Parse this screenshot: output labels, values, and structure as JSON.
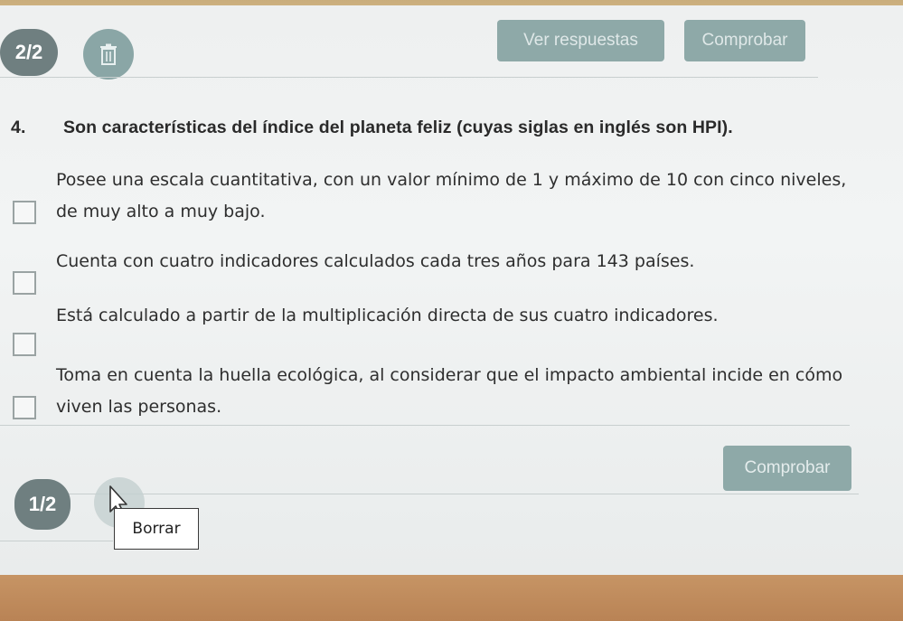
{
  "top_bar": {
    "progress_label": "2/2",
    "trash_icon": "trash-icon",
    "ver_respuestas_label": "Ver respuestas",
    "comprobar_label": "Comprobar"
  },
  "question": {
    "number": "4.",
    "text": "Son características del índice del planeta feliz (cuyas siglas en inglés son HPI).",
    "options": [
      {
        "text": "Posee una escala cuantitativa, con un valor mínimo de 1 y máximo de 10 con cinco niveles, de muy alto a muy bajo."
      },
      {
        "text": "Cuenta con cuatro indicadores calculados cada tres años para 143 países."
      },
      {
        "text": "Está calculado a partir de la multiplicación directa de sus cuatro indicadores."
      },
      {
        "text": "Toma en cuenta la huella ecológica, al considerar que el impacto ambiental incide en cómo viven las personas."
      }
    ]
  },
  "bottom_bar": {
    "comprobar_label": "Comprobar",
    "progress_label": "1/2",
    "tooltip_label": "Borrar",
    "trash_icon": "trash-icon",
    "cursor_icon": "mouse-pointer-icon"
  },
  "colors": {
    "button_bg": "#8ea9a8",
    "badge_bg": "#6f7f80",
    "text": "#2e2e2e"
  }
}
